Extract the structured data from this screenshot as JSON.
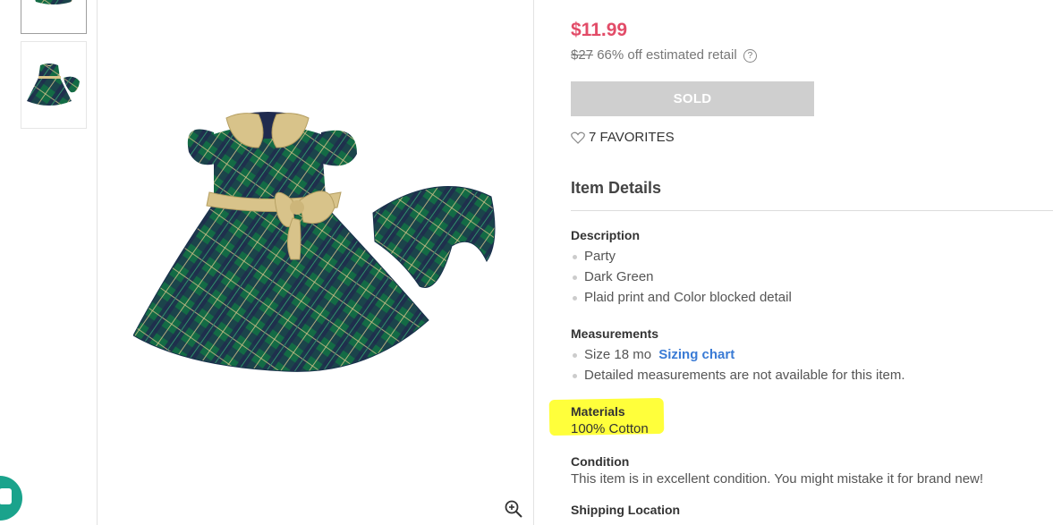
{
  "product": {
    "price": "$11.99",
    "original_price": "$27",
    "discount_text": "66% off estimated retail",
    "sold_label": "SOLD",
    "favorites_text": "7 FAVORITES"
  },
  "details": {
    "title": "Item Details",
    "description": {
      "label": "Description",
      "items": [
        "Party",
        "Dark Green",
        "Plaid print and Color blocked detail"
      ]
    },
    "measurements": {
      "label": "Measurements",
      "size": "Size 18 mo",
      "sizing_link": "Sizing chart",
      "note": "Detailed measurements are not available for this item."
    },
    "materials": {
      "label": "Materials",
      "value": "100% Cotton"
    },
    "condition": {
      "label": "Condition",
      "value": "This item is in excellent condition. You might mistake it for brand new!"
    },
    "shipping": {
      "label": "Shipping Location"
    }
  },
  "colors": {
    "price": "#e24c68",
    "link": "#3a7bd5",
    "highlight": "#ffff3b",
    "chat": "#1aa38c",
    "plaid_green": "#136b45",
    "plaid_navy": "#1f2a4e",
    "gold": "#d8c38a"
  },
  "icons": {
    "help": "question-circle-icon",
    "favorite": "heart-outline-icon",
    "zoom": "zoom-in-icon",
    "chat": "chat-icon"
  }
}
